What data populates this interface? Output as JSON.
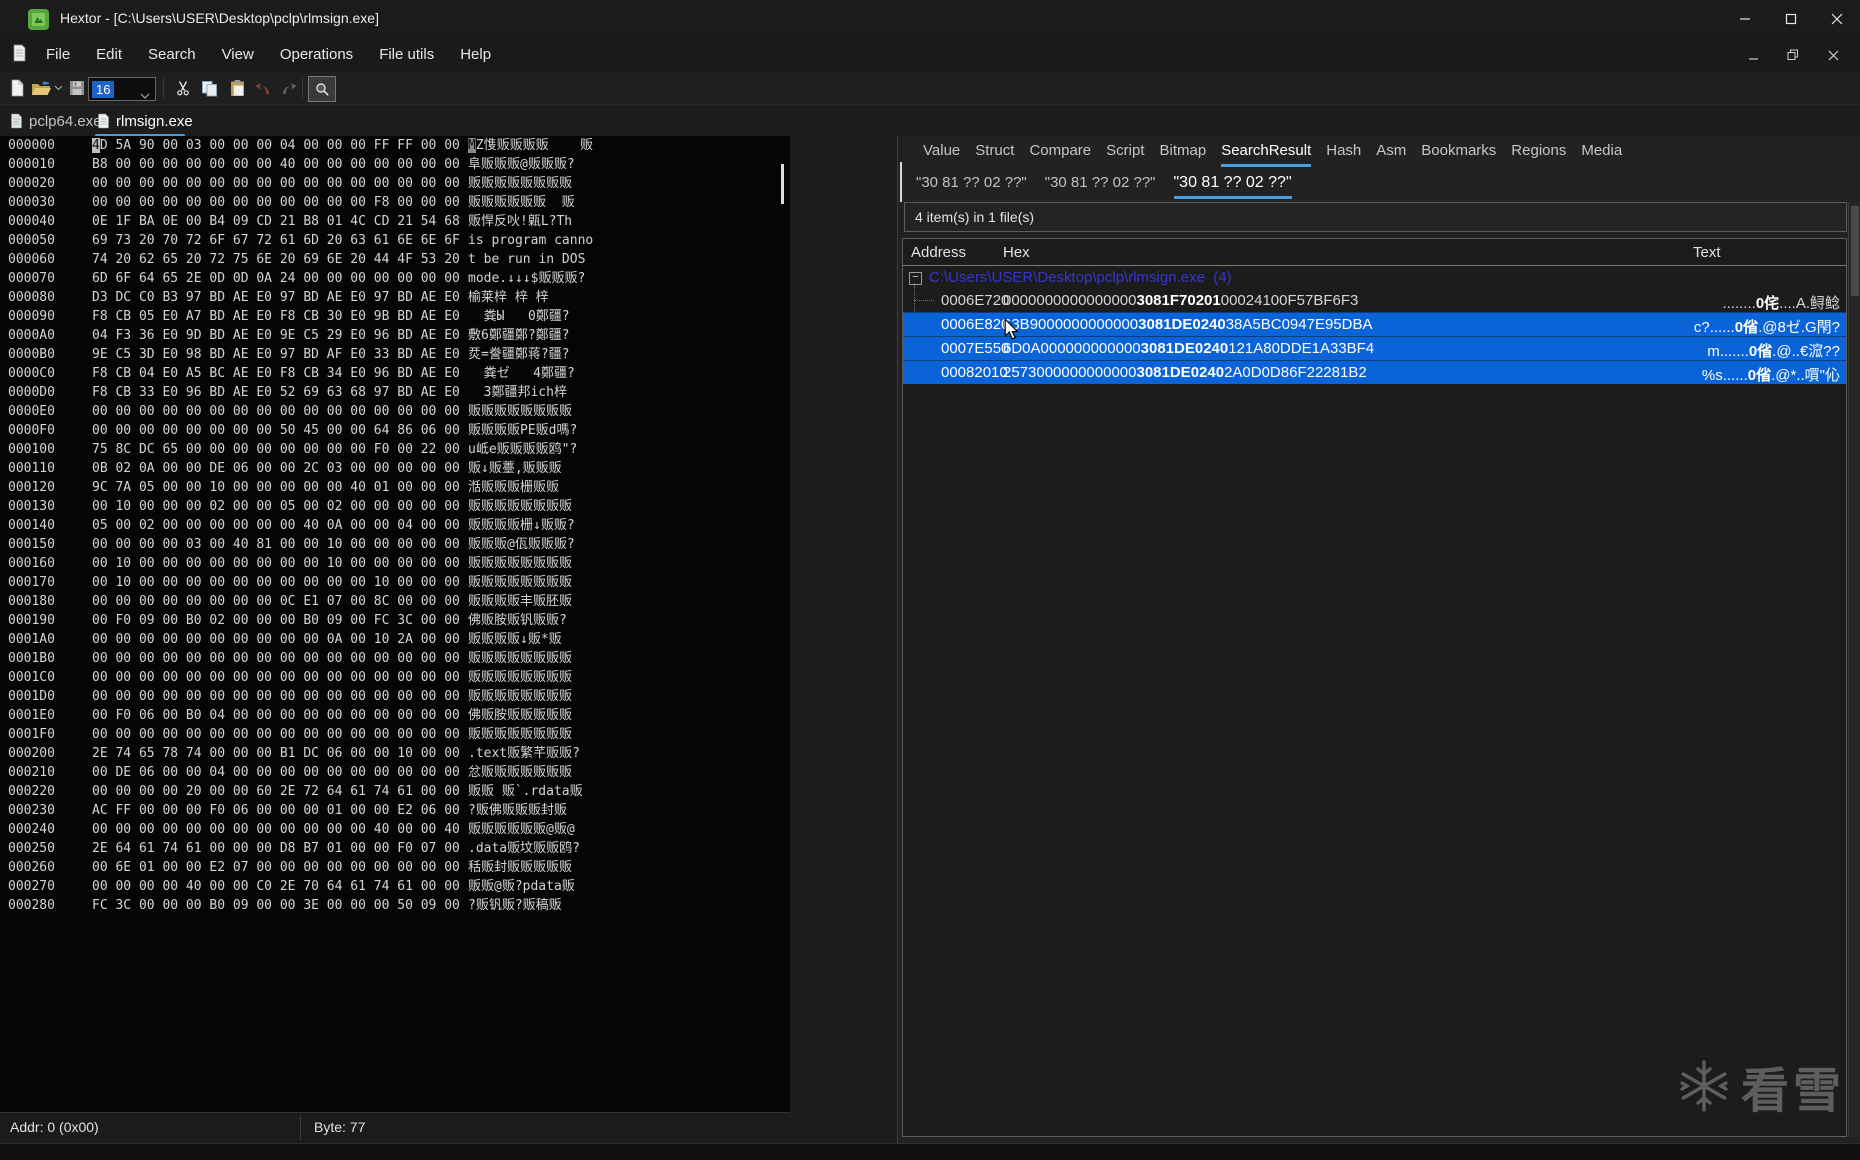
{
  "window": {
    "title": "Hextor - [C:\\Users\\USER\\Desktop\\pclp\\rlmsign.exe]"
  },
  "menu": {
    "items": [
      "File",
      "Edit",
      "Search",
      "View",
      "Operations",
      "File utils",
      "Help"
    ]
  },
  "toolbar": {
    "byte_width_value": "16",
    "icons": [
      "new-file-icon",
      "open-file-icon",
      "save-file-icon",
      "cut-icon",
      "copy-icon",
      "paste-icon",
      "undo-icon",
      "redo-icon",
      "find-icon"
    ]
  },
  "file_tabs": [
    {
      "label": "pclp64.exe",
      "active": false
    },
    {
      "label": "rlmsign.exe",
      "active": true
    }
  ],
  "hex_editor": {
    "cursor": {
      "row": 0
    },
    "rows": [
      {
        "addr": "000000",
        "hex": "4D 5A 90 00 03 00 00 00 04 00 00 00 FF FF 00 00",
        "text": "MZ愯贩贩贩贩    贩"
      },
      {
        "addr": "000010",
        "hex": "B8 00 00 00 00 00 00 00 40 00 00 00 00 00 00 00",
        "text": "阜贩贩贩@贩贩贩?"
      },
      {
        "addr": "000020",
        "hex": "00 00 00 00 00 00 00 00 00 00 00 00 00 00 00 00",
        "text": "贩贩贩贩贩贩贩贩"
      },
      {
        "addr": "000030",
        "hex": "00 00 00 00 00 00 00 00 00 00 00 00 F8 00 00 00",
        "text": "贩贩贩贩贩贩  贩"
      },
      {
        "addr": "000040",
        "hex": "0E 1F BA 0E 00 B4 09 CD 21 B8 01 4C CD 21 54 68",
        "text": "贩悍反吙!甈L?Th"
      },
      {
        "addr": "000050",
        "hex": "69 73 20 70 72 6F 67 72 61 6D 20 63 61 6E 6E 6F",
        "text": "is program canno"
      },
      {
        "addr": "000060",
        "hex": "74 20 62 65 20 72 75 6E 20 69 6E 20 44 4F 53 20",
        "text": "t be run in DOS "
      },
      {
        "addr": "000070",
        "hex": "6D 6F 64 65 2E 0D 0D 0A 24 00 00 00 00 00 00 00",
        "text": "mode.↓↓↓$贩贩贩?"
      },
      {
        "addr": "000080",
        "hex": "D3 DC C0 B3 97 BD AE E0 97 BD AE E0 97 BD AE E0",
        "text": "榆莱梓 梓 梓"
      },
      {
        "addr": "000090",
        "hex": "F8 CB 05 E0 A7 BD AE E0 F8 CB 30 E0 9B BD AE E0",
        "text": "  粪Ы   0鄭疆?"
      },
      {
        "addr": "0000A0",
        "hex": "04 F3 36 E0 9D BD AE E0 9E C5 29 E0 96 BD AE E0",
        "text": "敷6鄭疆鄭?鄭疆?"
      },
      {
        "addr": "0000B0",
        "hex": "9E C5 3D E0 98 BD AE E0 97 BD AF E0 33 BD AE E0",
        "text": "烎=誊疆鄭蒋?疆?"
      },
      {
        "addr": "0000C0",
        "hex": "F8 CB 04 E0 A5 BC AE E0 F8 CB 34 E0 96 BD AE E0",
        "text": "  粪ゼ   4鄭疆?"
      },
      {
        "addr": "0000D0",
        "hex": "F8 CB 33 E0 96 BD AE E0 52 69 63 68 97 BD AE E0",
        "text": "  3鄭疆邦ich梓"
      },
      {
        "addr": "0000E0",
        "hex": "00 00 00 00 00 00 00 00 00 00 00 00 00 00 00 00",
        "text": "贩贩贩贩贩贩贩贩"
      },
      {
        "addr": "0000F0",
        "hex": "00 00 00 00 00 00 00 00 50 45 00 00 64 86 06 00",
        "text": "贩贩贩贩PE贩d嗎?"
      },
      {
        "addr": "000100",
        "hex": "75 8C DC 65 00 00 00 00 00 00 00 00 F0 00 22 00",
        "text": "u岻e贩贩贩贩鸥\"?"
      },
      {
        "addr": "000110",
        "hex": "0B 02 0A 00 00 DE 06 00 00 2C 03 00 00 00 00 00",
        "text": "贩↓贩薹,贩贩贩"
      },
      {
        "addr": "000120",
        "hex": "9C 7A 05 00 00 10 00 00 00 00 00 40 01 00 00 00",
        "text": "湉贩贩贩栅贩贩"
      },
      {
        "addr": "000130",
        "hex": "00 10 00 00 00 02 00 00 05 00 02 00 00 00 00 00",
        "text": "贩贩贩贩贩贩贩贩"
      },
      {
        "addr": "000140",
        "hex": "05 00 02 00 00 00 00 00 00 40 0A 00 00 04 00 00",
        "text": "贩贩贩贩栅↓贩贩?"
      },
      {
        "addr": "000150",
        "hex": "00 00 00 00 03 00 40 81 00 00 10 00 00 00 00 00",
        "text": "贩贩贩@佤贩贩贩?"
      },
      {
        "addr": "000160",
        "hex": "00 10 00 00 00 00 00 00 00 00 10 00 00 00 00 00",
        "text": "贩贩贩贩贩贩贩贩"
      },
      {
        "addr": "000170",
        "hex": "00 10 00 00 00 00 00 00 00 00 00 00 10 00 00 00",
        "text": "贩贩贩贩贩贩贩贩"
      },
      {
        "addr": "000180",
        "hex": "00 00 00 00 00 00 00 00 0C E1 07 00 8C 00 00 00",
        "text": "贩贩贩贩丰贩胚贩"
      },
      {
        "addr": "000190",
        "hex": "00 F0 09 00 B0 02 00 00 00 B0 09 00 FC 3C 00 00",
        "text": "佛贩胺贩钒贩贩?"
      },
      {
        "addr": "0001A0",
        "hex": "00 00 00 00 00 00 00 00 00 00 0A 00 10 2A 00 00",
        "text": "贩贩贩贩↓贩*贩"
      },
      {
        "addr": "0001B0",
        "hex": "00 00 00 00 00 00 00 00 00 00 00 00 00 00 00 00",
        "text": "贩贩贩贩贩贩贩贩"
      },
      {
        "addr": "0001C0",
        "hex": "00 00 00 00 00 00 00 00 00 00 00 00 00 00 00 00",
        "text": "贩贩贩贩贩贩贩贩"
      },
      {
        "addr": "0001D0",
        "hex": "00 00 00 00 00 00 00 00 00 00 00 00 00 00 00 00",
        "text": "贩贩贩贩贩贩贩贩"
      },
      {
        "addr": "0001E0",
        "hex": "00 F0 06 00 B0 04 00 00 00 00 00 00 00 00 00 00",
        "text": "佛贩胺贩贩贩贩贩"
      },
      {
        "addr": "0001F0",
        "hex": "00 00 00 00 00 00 00 00 00 00 00 00 00 00 00 00",
        "text": "贩贩贩贩贩贩贩贩"
      },
      {
        "addr": "000200",
        "hex": "2E 74 65 78 74 00 00 00 B1 DC 06 00 00 10 00 00",
        "text": ".text贩繁芊贩贩?"
      },
      {
        "addr": "000210",
        "hex": "00 DE 06 00 00 04 00 00 00 00 00 00 00 00 00 00",
        "text": "忿贩贩贩贩贩贩贩"
      },
      {
        "addr": "000220",
        "hex": "00 00 00 00 20 00 00 60 2E 72 64 61 74 61 00 00",
        "text": "贩贩 贩`.rdata贩"
      },
      {
        "addr": "000230",
        "hex": "AC FF 00 00 00 F0 06 00 00 00 01 00 00 E2 06 00",
        "text": "?贩佛贩贩贩封贩"
      },
      {
        "addr": "000240",
        "hex": "00 00 00 00 00 00 00 00 00 00 00 00 40 00 00 40",
        "text": "贩贩贩贩贩贩@贩@"
      },
      {
        "addr": "000250",
        "hex": "2E 64 61 74 61 00 00 00 D8 B7 01 00 00 F0 07 00",
        "text": ".data贩坟贩贩鸥?"
      },
      {
        "addr": "000260",
        "hex": "00 6E 01 00 00 E2 07 00 00 00 00 00 00 00 00 00",
        "text": "秳贩封贩贩贩贩贩"
      },
      {
        "addr": "000270",
        "hex": "00 00 00 00 40 00 00 C0 2E 70 64 61 74 61 00 00",
        "text": "贩贩@贩?pdata贩"
      },
      {
        "addr": "000280",
        "hex": "FC 3C 00 00 00 B0 09 00 00 3E 00 00 00 50 09 00",
        "text": "?贩钒贩?贩稿贩"
      }
    ]
  },
  "right_panel": {
    "tabs": [
      "Value",
      "Struct",
      "Compare",
      "Script",
      "Bitmap",
      "SearchResult",
      "Hash",
      "Asm",
      "Bookmarks",
      "Regions",
      "Media"
    ],
    "active_tab": "SearchResult",
    "search_tabs": [
      "\"30 81 ?? 02 ??\"",
      "\"30 81 ?? 02 ??\"",
      "\"30 81 ?? 02 ??\""
    ],
    "active_search_tab": 2,
    "summary": "4 item(s) in 1 file(s)",
    "columns": [
      "Address",
      "Hex",
      "Text"
    ],
    "tree_root": "C:\\Users\\USER\\Desktop\\pclp\\rlmsign.exe  (4)",
    "results": [
      {
        "address": "0006E720",
        "hex_pre": "0000000000000000",
        "hex_match": "3081F70201",
        "hex_post": "00024100F57BF6F3",
        "text_pre": "........",
        "text_match": "0侘",
        "text_post": "....A.鲟鲶",
        "selected": false
      },
      {
        "address": "0006E820",
        "hex_pre": "63B9000000000000",
        "hex_match": "3081DE0240",
        "hex_post": "38A5BC0947E95DBA",
        "text_pre": "c?......",
        "text_match": "0偗",
        "text_post": ".@8ゼ.G閇?",
        "selected": true
      },
      {
        "address": "0007E550",
        "hex_pre": "6D0A000000000000",
        "hex_match": "3081DE0240",
        "hex_post": "121A80DDE1A33BF4",
        "text_pre": "m.......",
        "text_match": "0偗",
        "text_post": ".@..€溛??",
        "selected": true
      },
      {
        "address": "00082010",
        "hex_pre": "2573000000000000",
        "hex_match": "3081DE0240",
        "hex_post": "2A0D0D86F22281B2",
        "text_pre": "%s......",
        "text_match": "0偗",
        "text_post": ".@*..嘪\"伈",
        "selected": true
      }
    ]
  },
  "status_bar": {
    "addr": "Addr: 0 (0x00)",
    "byte": "Byte: 77"
  },
  "watermark": {
    "text": "看雪"
  },
  "colors": {
    "accent": "#4a9ede",
    "selection": "#0a64d8",
    "link": "#3636cf",
    "background": "#1d1d1d"
  }
}
